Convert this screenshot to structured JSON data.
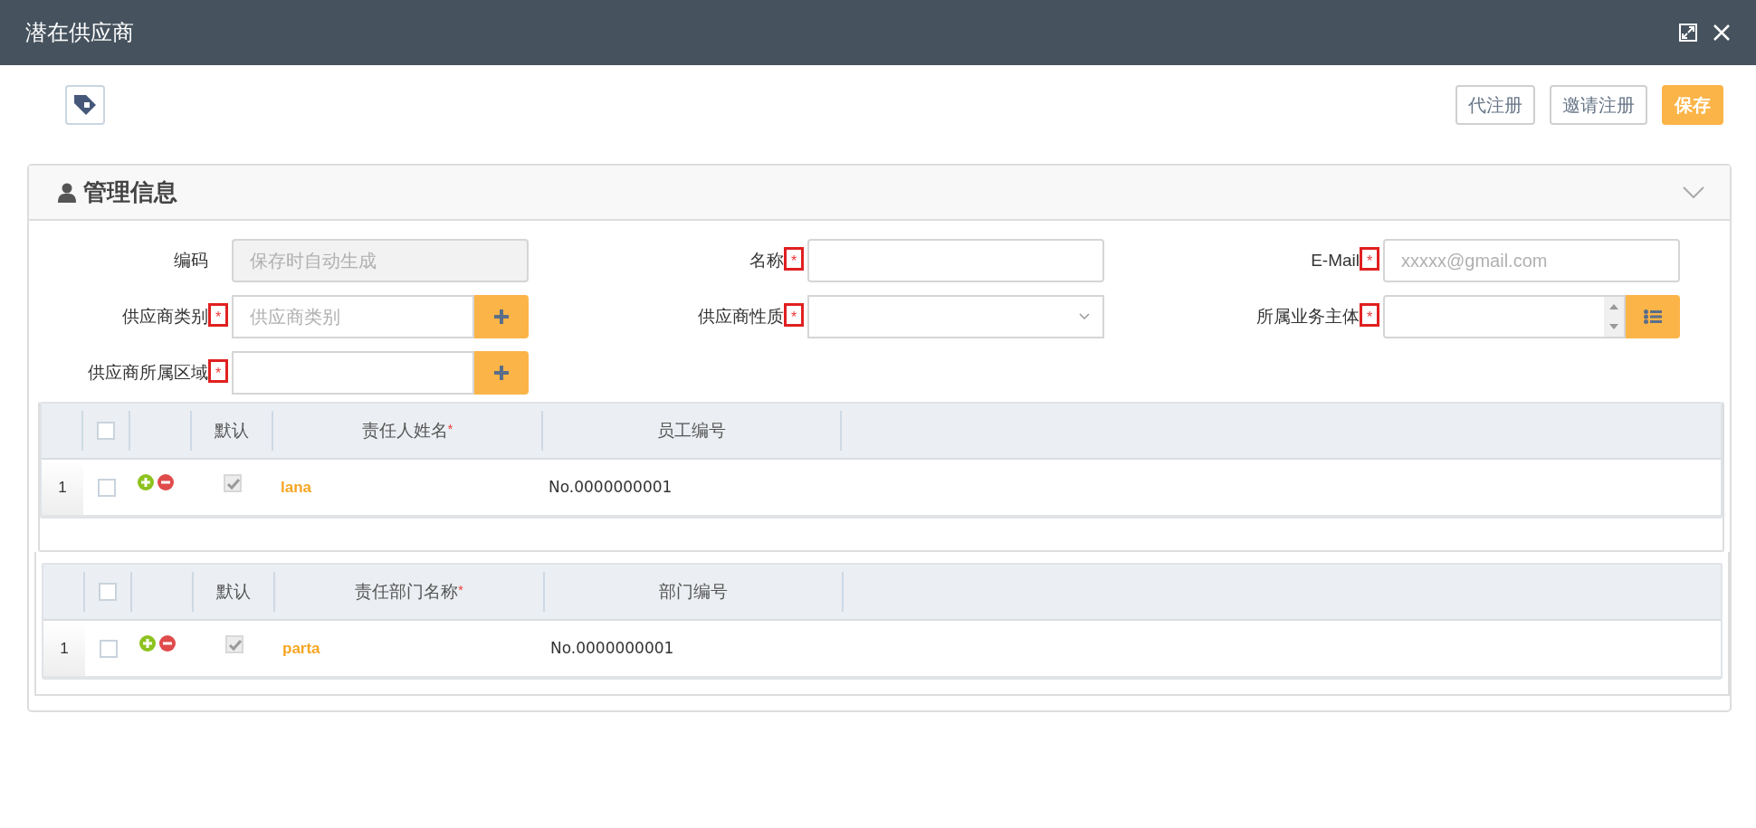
{
  "window": {
    "title": "潜在供应商"
  },
  "toolbar": {
    "buttons": [
      {
        "label": "代注册",
        "kind": "outline"
      },
      {
        "label": "邀请注册",
        "kind": "outline"
      },
      {
        "label": "保存",
        "kind": "primary"
      }
    ]
  },
  "panel": {
    "title": "管理信息",
    "expanded": true,
    "fields": [
      {
        "label": "编码",
        "kind": "text",
        "placeholder": "保存时自动生成",
        "disabled": true
      },
      {
        "label": "名称",
        "kind": "text",
        "required_mark": "*",
        "highlighted": true,
        "disabled": false
      },
      {
        "label": "E-Mail",
        "kind": "text",
        "required_mark": "*",
        "highlighted": true,
        "placeholder": "xxxxx@gmail.com",
        "disabled": false
      },
      {
        "label": "供应商类别",
        "kind": "add",
        "required_mark": "*",
        "highlighted": true,
        "placeholder": "供应商类别",
        "disabled": false
      },
      {
        "label": "供应商性质",
        "kind": "select",
        "required_mark": "*",
        "highlighted": true,
        "disabled": false
      },
      {
        "label": "所属业务主体",
        "kind": "spinner-list",
        "required_mark": "*",
        "highlighted": true,
        "disabled": false
      },
      {
        "label": "供应商所属区域",
        "kind": "add",
        "required_mark": "*",
        "highlighted": true,
        "disabled": false
      }
    ],
    "grids": [
      {
        "header_checked": false,
        "columns": [
          {
            "label": "默认"
          },
          {
            "label": "责任人姓名",
            "required_mark": "*"
          },
          {
            "label": "员工编号"
          }
        ],
        "rows": [
          {
            "number": "1",
            "selected": false,
            "default": true,
            "name": "lana",
            "code": "No.0000000001"
          }
        ]
      },
      {
        "header_checked": false,
        "columns": [
          {
            "label": "默认"
          },
          {
            "label": "责任部门名称",
            "required_mark": "*"
          },
          {
            "label": "部门编号"
          }
        ],
        "rows": [
          {
            "number": "1",
            "selected": false,
            "default": true,
            "name": "parta",
            "code": "No.0000000001"
          }
        ]
      }
    ]
  }
}
